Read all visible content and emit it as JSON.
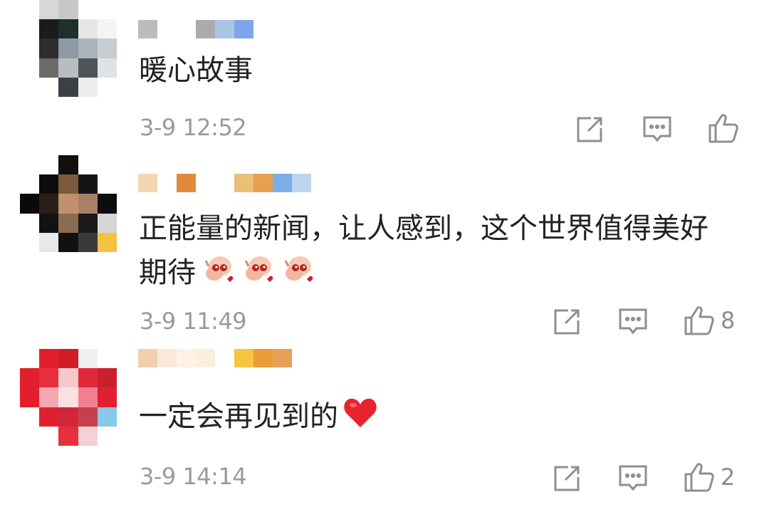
{
  "comments": [
    {
      "text": "暖心故事",
      "time": "3-9 12:52",
      "like_count": "",
      "avatar_colors": [
        "#ffffff",
        "#d8d8d8",
        "#c8c8c8",
        "#ffffff",
        "#ffffff",
        "#ffffff",
        "#1b1b1b",
        "#1f2f2b",
        "#e6e6e6",
        "#f4f4f4",
        "#ffffff",
        "#2d2d2d",
        "#8d9aa3",
        "#a9b3b9",
        "#c6ccd0",
        "#ffffff",
        "#6b6b6b",
        "#b7bdc1",
        "#4d5358",
        "#e0e3e5",
        "#ffffff",
        "#ffffff",
        "#3b4044",
        "#eceeef",
        "#ffffff"
      ],
      "name_colors": [
        "#bcbcbc",
        "#ffffff",
        "#ffffff",
        "#ababab",
        "#aac6e6",
        "#7ea6ea"
      ]
    },
    {
      "text": "正能量的新闻，让人感到，这个世界值得美好",
      "text2": "期待",
      "emoji": "hand-heart-eyes-sticker",
      "time": "3-9 11:49",
      "like_count": "8",
      "avatar_colors": [
        "#ffffff",
        "#ffffff",
        "#101010",
        "#ffffff",
        "#ffffff",
        "#ffffff",
        "#0c0c0c",
        "#7c5a3c",
        "#141414",
        "#ffffff",
        "#0a0a0a",
        "#2a1f18",
        "#c09070",
        "#a78066",
        "#0d0d0d",
        "#ffffff",
        "#121212",
        "#8b6a52",
        "#1a1a1a",
        "#d6d6d6",
        "#ffffff",
        "#e8e8e8",
        "#111111",
        "#3a3a3a",
        "#f2c240"
      ],
      "name_colors": [
        "#f3d5b4",
        "#ffffff",
        "#e08a3c",
        "#ffffff",
        "#ffffff",
        "#e8c07a",
        "#e8a050",
        "#7aaee8",
        "#bcd4ef"
      ]
    },
    {
      "text": "一定会再见到的",
      "emoji": "red-heart",
      "time": "3-9 14:14",
      "like_count": "2",
      "avatar_colors": [
        "#ffffff",
        "#e41f2c",
        "#d21d28",
        "#f0f0f0",
        "#ffffff",
        "#e0202c",
        "#e8303c",
        "#f5c8cc",
        "#e0283a",
        "#c92030",
        "#e41f2c",
        "#f4a8b0",
        "#fbe0e2",
        "#f08090",
        "#e02030",
        "#ffffff",
        "#e02030",
        "#d0283a",
        "#c84050",
        "#88c8e8",
        "#ffffff",
        "#ffffff",
        "#e8303c",
        "#f5d0d4",
        "#ffffff"
      ],
      "name_colors": [
        "#f3cfb0",
        "#fce8d8",
        "#fdf2e6",
        "#fbeedd",
        "#ffffff",
        "#f4c640",
        "#ea9b3a",
        "#e5a15a"
      ]
    }
  ],
  "icons": {
    "share": "share-icon",
    "comment": "comment-icon",
    "like": "thumbs-up-icon"
  },
  "colors": {
    "text": "#222222",
    "meta": "#9a9a9a",
    "icon": "#8f8f8f"
  }
}
